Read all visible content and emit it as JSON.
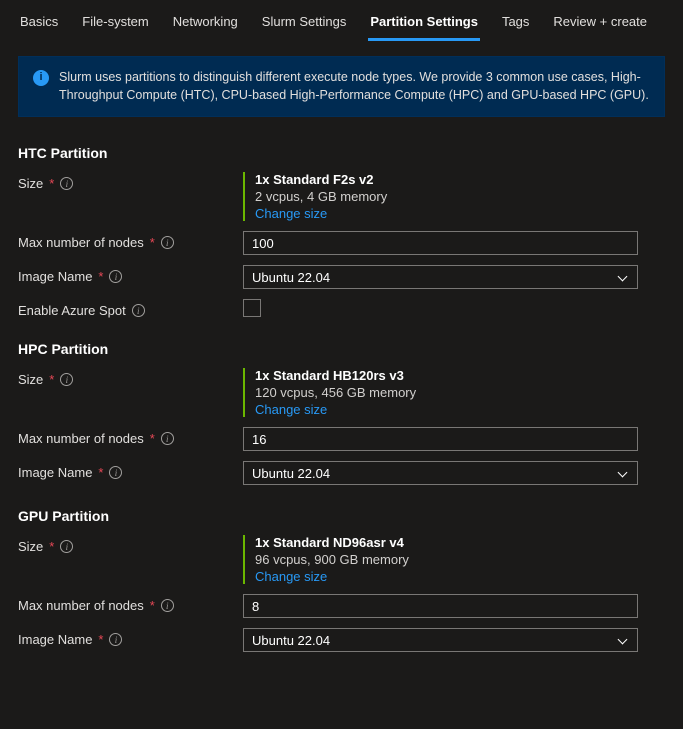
{
  "tabs": [
    {
      "label": "Basics"
    },
    {
      "label": "File-system"
    },
    {
      "label": "Networking"
    },
    {
      "label": "Slurm Settings"
    },
    {
      "label": "Partition Settings",
      "active": true
    },
    {
      "label": "Tags"
    },
    {
      "label": "Review + create"
    }
  ],
  "banner": {
    "text": "Slurm uses partitions to distinguish different execute node types. We provide 3 common use cases, High-Throughput Compute (HTC), CPU-based High-Performance Compute (HPC) and GPU-based HPC (GPU)."
  },
  "sections": {
    "htc": {
      "title": "HTC Partition",
      "size_label": "Size",
      "size_title": "1x Standard F2s v2",
      "size_sub": "2 vcpus, 4 GB memory",
      "change": "Change size",
      "max_label": "Max number of nodes",
      "max_value": "100",
      "image_label": "Image Name",
      "image_value": "Ubuntu 22.04",
      "spot_label": "Enable Azure Spot"
    },
    "hpc": {
      "title": "HPC Partition",
      "size_label": "Size",
      "size_title": "1x Standard HB120rs v3",
      "size_sub": "120 vcpus, 456 GB memory",
      "change": "Change size",
      "max_label": "Max number of nodes",
      "max_value": "16",
      "image_label": "Image Name",
      "image_value": "Ubuntu 22.04"
    },
    "gpu": {
      "title": "GPU Partition",
      "size_label": "Size",
      "size_title": "1x Standard ND96asr v4",
      "size_sub": "96 vcpus, 900 GB memory",
      "change": "Change size",
      "max_label": "Max number of nodes",
      "max_value": "8",
      "image_label": "Image Name",
      "image_value": "Ubuntu 22.04"
    }
  }
}
